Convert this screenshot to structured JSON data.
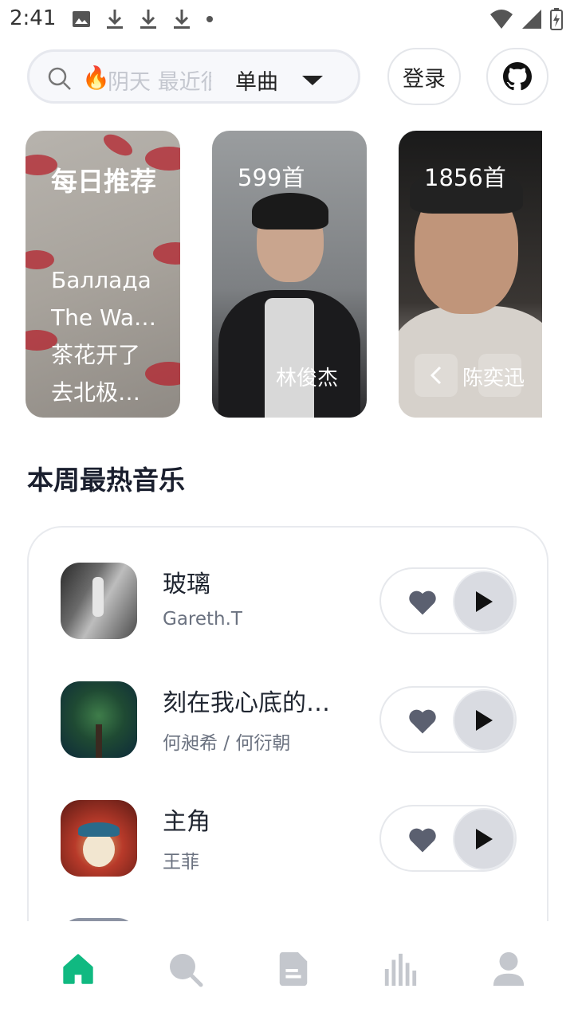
{
  "status_bar": {
    "time": "2:41",
    "left_icons": [
      "image-icon",
      "download-icon",
      "download-icon",
      "download-icon",
      "dot-icon"
    ],
    "right_icons": [
      "wifi-icon",
      "signal-icon",
      "battery-charging-icon"
    ]
  },
  "search": {
    "emoji": "🔥",
    "placeholder": "阴天 最近很",
    "type_label": "单曲"
  },
  "header": {
    "login_label": "登录",
    "github_icon": "github-icon"
  },
  "carousel": {
    "daily": {
      "title": "每日推荐",
      "songs": [
        "Баллада",
        "The Wa…",
        "茶花开了",
        "去北极…"
      ]
    },
    "artists": [
      {
        "count": "599首",
        "name": "林俊杰"
      },
      {
        "count": "1856首",
        "name": "陈奕迅"
      }
    ]
  },
  "section": {
    "title": "本周最热音乐"
  },
  "songs": [
    {
      "title": "玻璃",
      "artist": "Gareth.T"
    },
    {
      "title": "刻在我心底的…",
      "artist": "何昶希 / 何衍朝"
    },
    {
      "title": "主角",
      "artist": "王菲"
    }
  ],
  "tabs": [
    {
      "icon": "home-icon",
      "active": true
    },
    {
      "icon": "search-icon",
      "active": false
    },
    {
      "icon": "document-icon",
      "active": false
    },
    {
      "icon": "chart-bars-icon",
      "active": false
    },
    {
      "icon": "user-icon",
      "active": false
    }
  ],
  "colors": {
    "accent": "#10b981",
    "inactive_icon": "#c4c7cd",
    "heart": "#5b6070",
    "play_bg": "#d9dbe1"
  }
}
